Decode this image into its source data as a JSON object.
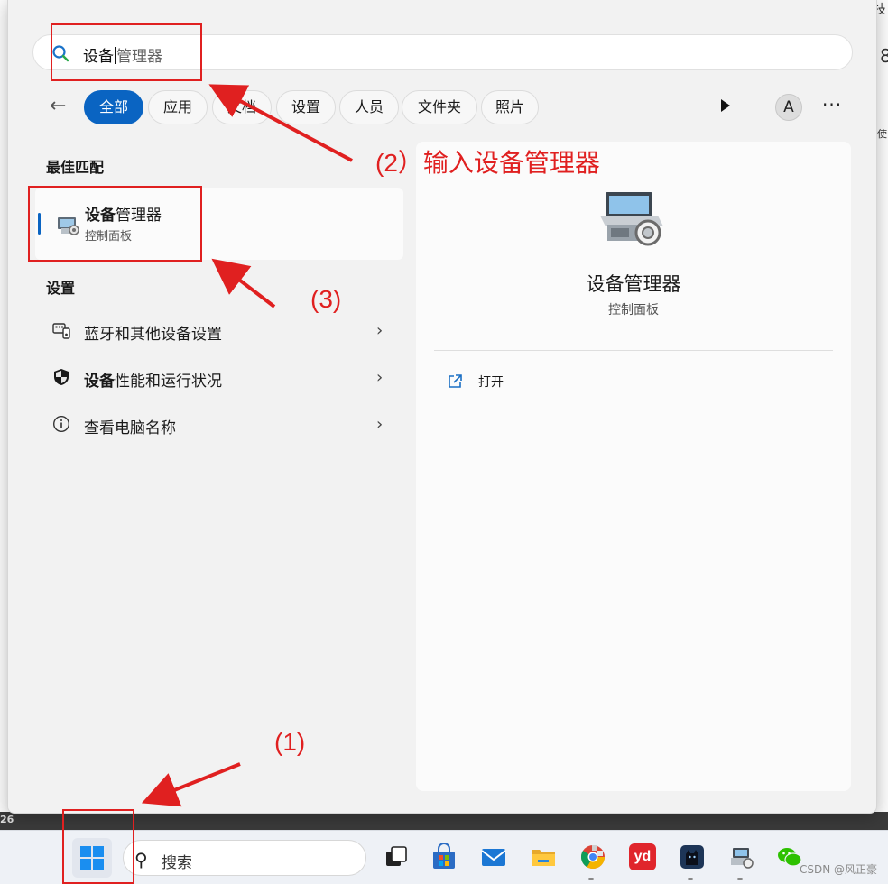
{
  "background_edge": {
    "right_top": "技",
    "right_digit": "8",
    "right_mid": "使",
    "left_clock": "26"
  },
  "search": {
    "query_typed": "设备",
    "query_suggest": "管理器",
    "icon": "search-icon"
  },
  "filters": {
    "back_icon": "arrow-left-icon",
    "chips": [
      "全部",
      "应用",
      "文档",
      "设置",
      "人员",
      "文件夹",
      "照片"
    ],
    "active_index": 0,
    "play_icon": "play-icon",
    "avatar_letter": "A",
    "more_icon": "more-icon",
    "more_text": "···"
  },
  "best_match": {
    "heading": "最佳匹配",
    "title_bold": "设备",
    "title_rest": "管理器",
    "subtitle": "控制面板",
    "icon": "device-manager-icon"
  },
  "settings": {
    "heading": "设置",
    "items": [
      {
        "icon": "bluetooth-devices-icon",
        "bold": "",
        "text": "蓝牙和其他设备设置",
        "chevron": "›"
      },
      {
        "icon": "shield-icon",
        "bold": "设备",
        "text": "性能和运行状况",
        "chevron": "›"
      },
      {
        "icon": "info-icon",
        "bold": "",
        "text": "查看电脑名称",
        "chevron": "›"
      }
    ]
  },
  "preview": {
    "title": "设备管理器",
    "subtitle": "控制面板",
    "action_label": "打开",
    "action_icon": "open-external-icon"
  },
  "taskbar": {
    "start_icon": "windows-start-icon",
    "search_placeholder": "搜索",
    "search_icon": "search-icon",
    "apps": [
      "task-view-icon",
      "microsoft-store-icon",
      "mail-icon",
      "file-explorer-icon",
      "chrome-icon",
      "youdao-icon",
      "cat-app-icon",
      "device-manager-icon",
      "wechat-icon"
    ],
    "youdao_text": "yd",
    "watermark": "CSDN @风正豪"
  },
  "annotations": {
    "step1": "(1)",
    "step2": "(2）输入设备管理器",
    "step3": "(3)",
    "color": "#e02020"
  },
  "colors": {
    "accent": "#0a64c2",
    "annotation": "#e02020",
    "panel_bg": "#f2f2f2"
  }
}
